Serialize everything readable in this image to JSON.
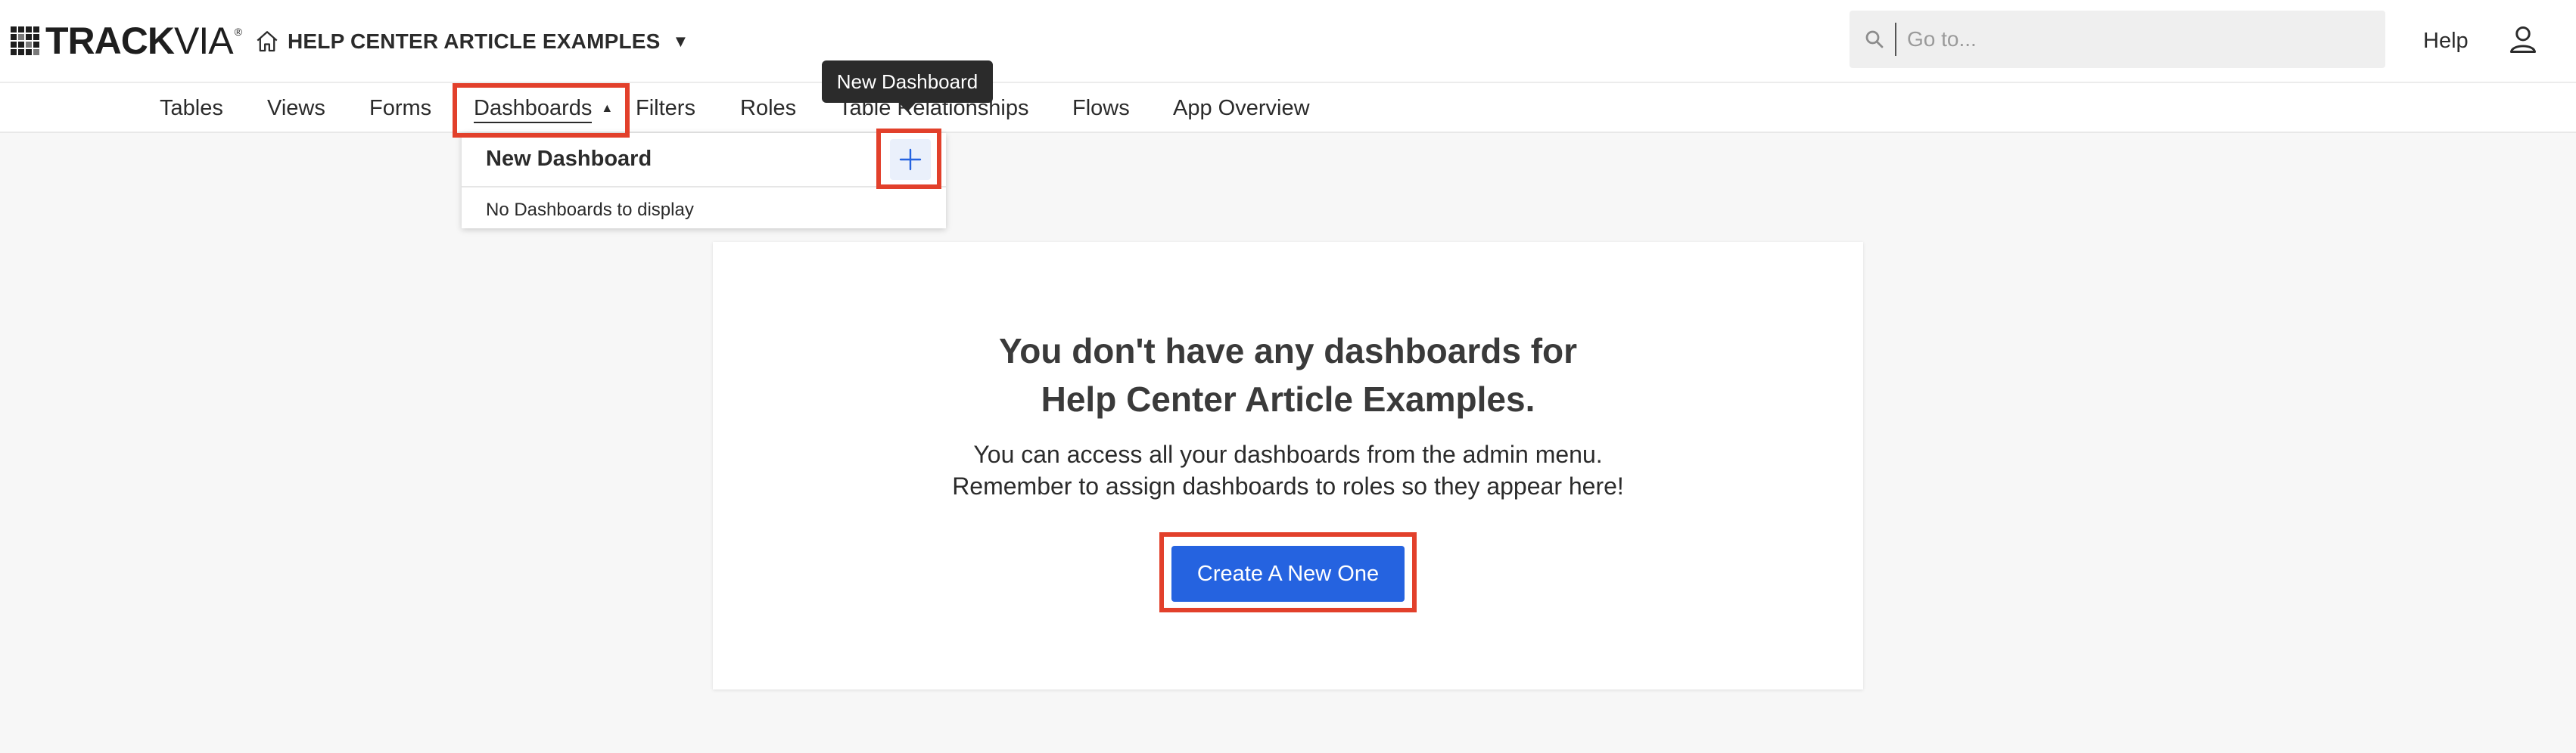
{
  "header": {
    "logo_text_bold": "TRACK",
    "logo_text_light": "VIA",
    "logo_trademark": "®",
    "app_name": "HELP CENTER ARTICLE EXAMPLES",
    "search_placeholder": "Go to...",
    "help_label": "Help"
  },
  "nav": {
    "items": [
      {
        "label": "Tables"
      },
      {
        "label": "Views"
      },
      {
        "label": "Forms"
      },
      {
        "label": "Dashboards",
        "active": true
      },
      {
        "label": "Filters"
      },
      {
        "label": "Roles"
      },
      {
        "label": "Table Relationships"
      },
      {
        "label": "Flows"
      },
      {
        "label": "App Overview"
      }
    ]
  },
  "dropdown": {
    "title": "New Dashboard",
    "empty_text": "No Dashboards to display"
  },
  "tooltip": {
    "text": "New Dashboard"
  },
  "main": {
    "title_line1": "You don't have any dashboards for",
    "title_line2": "Help Center Article Examples.",
    "text_line1": "You can access all your dashboards from the admin menu.",
    "text_line2": "Remember to assign dashboards to roles so they appear here!",
    "button_label": "Create A New One"
  },
  "colors": {
    "primary_button": "#2563e0",
    "highlight": "#e2402b",
    "add_button_bg": "#eaf0fb"
  }
}
